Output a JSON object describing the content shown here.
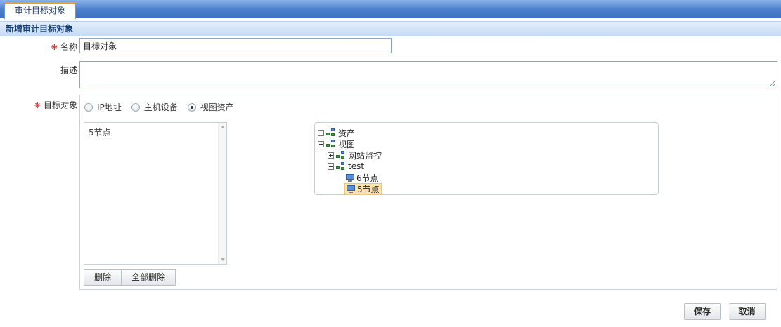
{
  "tabs": [
    {
      "label": "审计目标对象"
    }
  ],
  "section_title": "新增审计目标对象",
  "form": {
    "name": {
      "label": "名称",
      "value": "目标对象"
    },
    "description": {
      "label": "描述",
      "value": ""
    },
    "target": {
      "label": "目标对象",
      "radio_options": [
        {
          "label": "IP地址",
          "checked": false
        },
        {
          "label": "主机设备",
          "checked": false
        },
        {
          "label": "视图资产",
          "checked": true
        }
      ],
      "selected_items": [
        "5节点"
      ],
      "buttons": {
        "delete": "删除",
        "delete_all": "全部删除"
      }
    }
  },
  "tree": {
    "assets": "资产",
    "views": "视图",
    "website_monitor": "网站监控",
    "test": "test",
    "node6": "6节点",
    "node5": "5节点"
  },
  "actions": {
    "save": "保存",
    "cancel": "取消"
  },
  "colors": {
    "required_marker": "#d8201a",
    "highlight": "#fbe4b0",
    "tab_accent": "#f0a020"
  }
}
